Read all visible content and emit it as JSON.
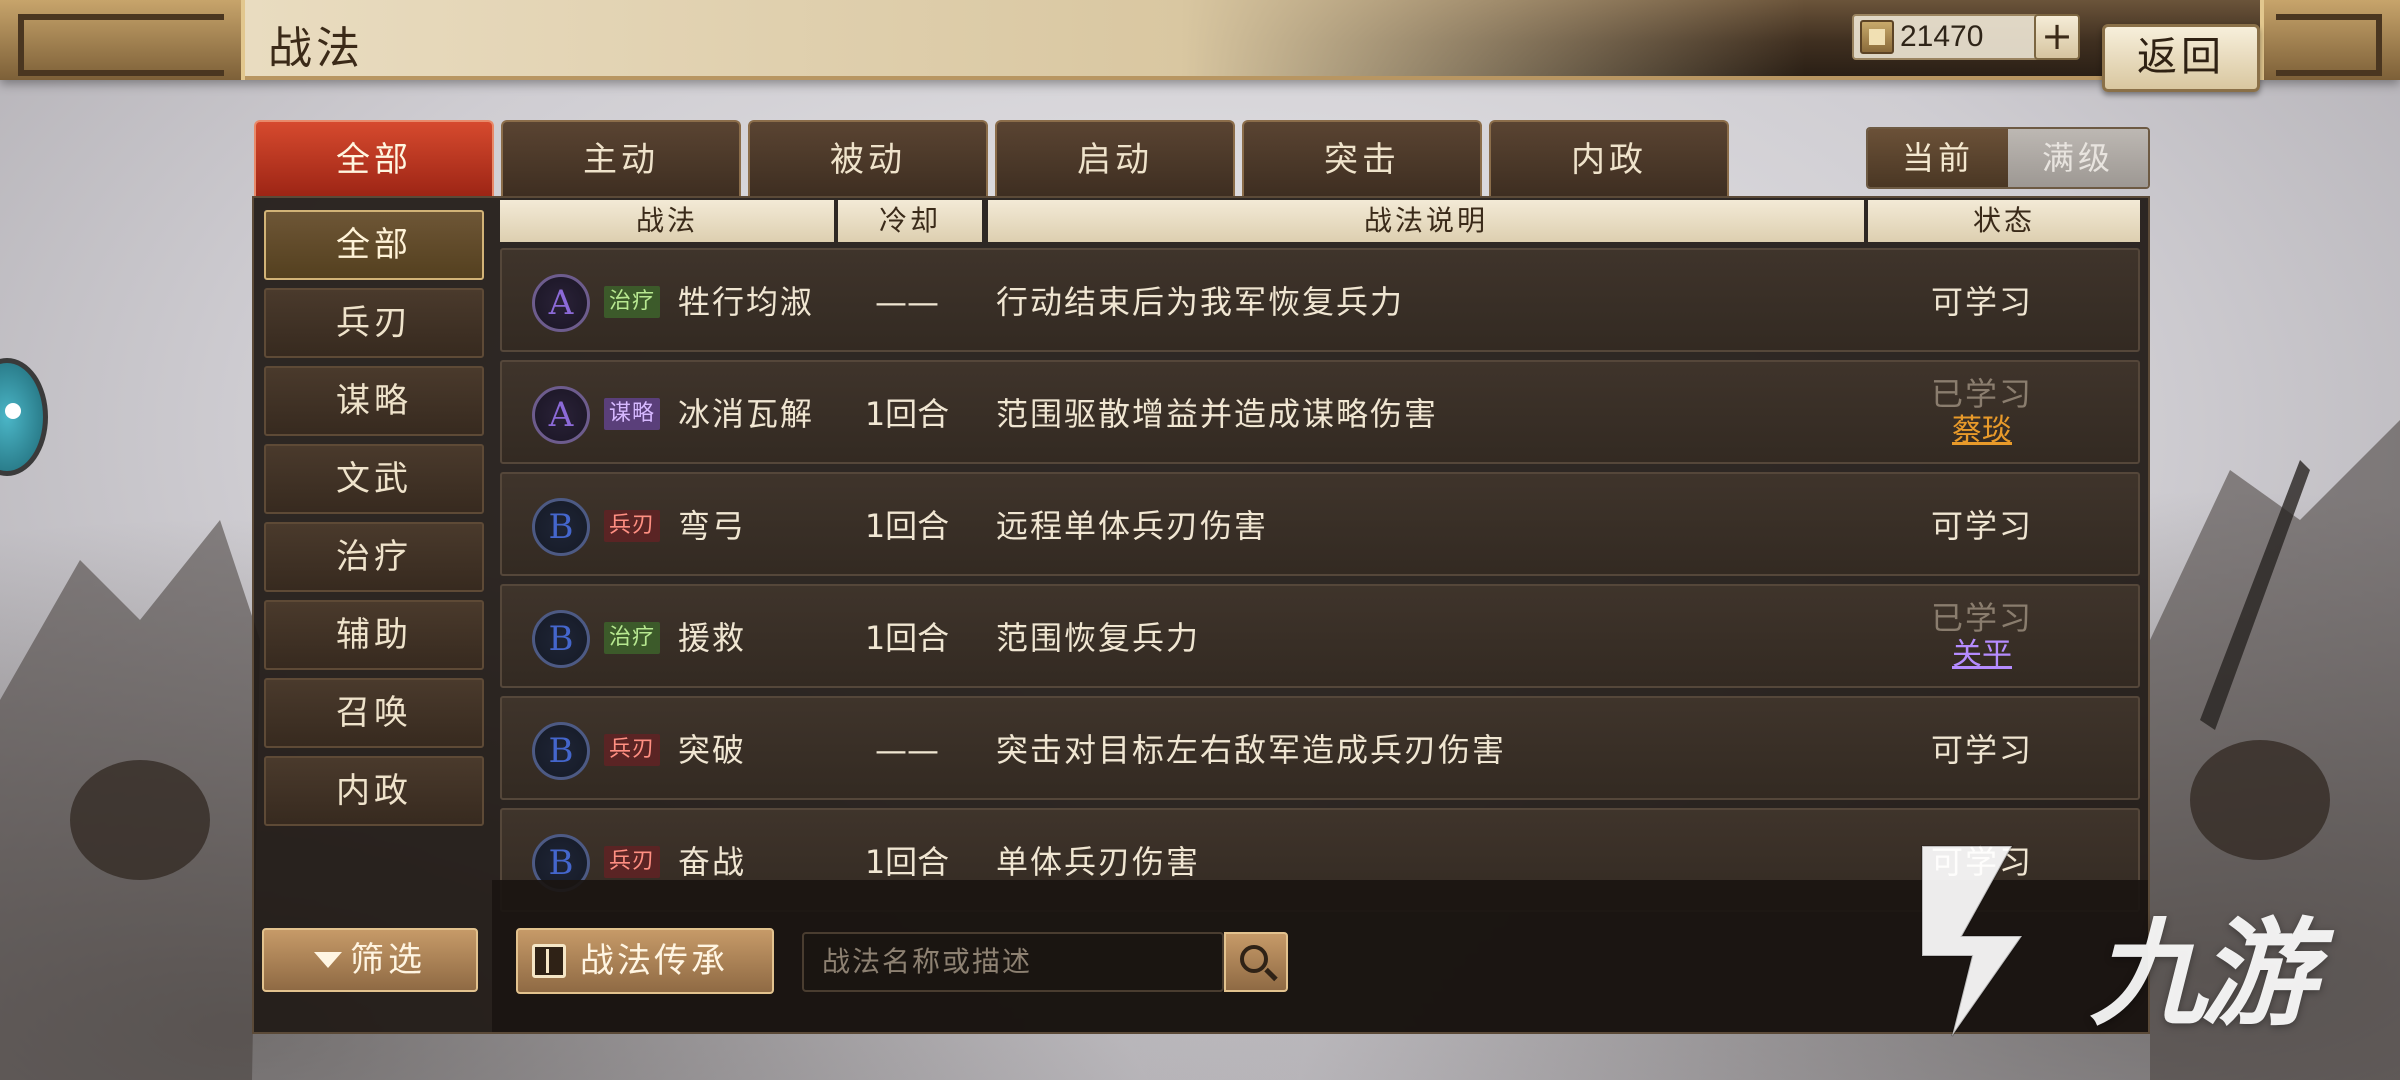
{
  "header": {
    "title": "战法",
    "currency_value": "21470",
    "add_label": "+",
    "back_label": "返回"
  },
  "tabs": [
    "全部",
    "主动",
    "被动",
    "启动",
    "突击",
    "内政"
  ],
  "level_toggle": {
    "current": "当前",
    "max": "满级"
  },
  "sidebar": [
    "全部",
    "兵刃",
    "谋略",
    "文武",
    "治疗",
    "辅助",
    "召唤",
    "内政"
  ],
  "table": {
    "headers": {
      "skill": "战法",
      "cooldown": "冷却",
      "description": "战法说明",
      "status": "状态"
    },
    "rows": [
      {
        "grade": "A",
        "type": "治疗",
        "name": "牲行均淑",
        "cooldown": "——",
        "description": "行动结束后为我军恢复兵力",
        "status": "可学习",
        "learner": ""
      },
      {
        "grade": "A",
        "type": "谋略",
        "name": "冰消瓦解",
        "cooldown": "1回合",
        "description": "范围驱散增益并造成谋略伤害",
        "status": "已学习",
        "learner": "蔡琰"
      },
      {
        "grade": "B",
        "type": "兵刃",
        "name": "弯弓",
        "cooldown": "1回合",
        "description": "远程单体兵刃伤害",
        "status": "可学习",
        "learner": ""
      },
      {
        "grade": "B",
        "type": "治疗",
        "name": "援救",
        "cooldown": "1回合",
        "description": "范围恢复兵力",
        "status": "已学习",
        "learner": "关平"
      },
      {
        "grade": "B",
        "type": "兵刃",
        "name": "突破",
        "cooldown": "——",
        "description": "突击对目标左右敌军造成兵刃伤害",
        "status": "可学习",
        "learner": ""
      },
      {
        "grade": "B",
        "type": "兵刃",
        "name": "奋战",
        "cooldown": "1回合",
        "description": "单体兵刃伤害",
        "status": "可学习",
        "learner": ""
      }
    ]
  },
  "bottom": {
    "filter_label": "筛选",
    "inherit_label": "战法传承",
    "search_placeholder": "战法名称或描述"
  },
  "watermark": "九游",
  "colors": {
    "tab_active": "#c23a22",
    "heal_badge": "#3c5a2a",
    "strategy_badge": "#5a3f7a",
    "blade_badge": "#5a2424",
    "learner_orange": "#e89a2a",
    "learner_purple": "#b58cff"
  }
}
